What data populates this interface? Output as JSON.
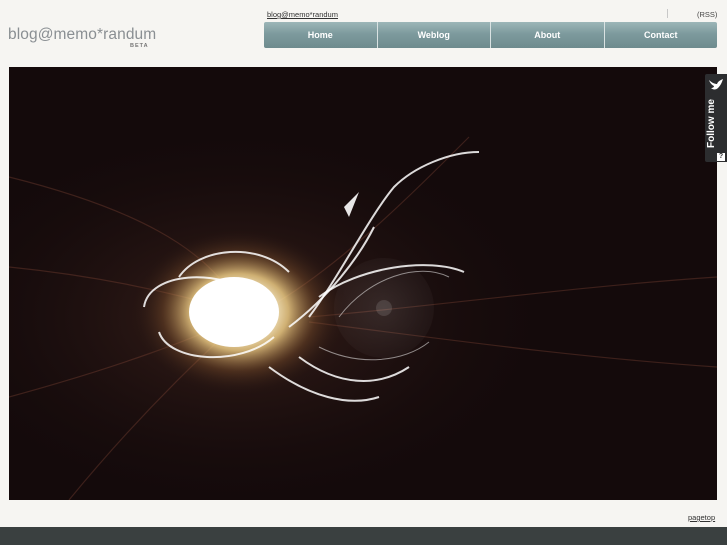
{
  "brand": {
    "logo_text": "blog@memo*randum",
    "beta_label": "BETA"
  },
  "header": {
    "top_link": "blog@memo*randum",
    "rss_label": "(RSS)"
  },
  "nav": {
    "items": [
      {
        "label": "Home"
      },
      {
        "label": "Weblog"
      },
      {
        "label": "About"
      },
      {
        "label": "Contact"
      }
    ]
  },
  "follow_widget": {
    "label": "Follow me",
    "help": "?"
  },
  "footer": {
    "pagetop_label": "pagetop"
  },
  "colors": {
    "background": "#f6f5f2",
    "nav": "#7d9a9d",
    "hero": "#140a0b",
    "footer": "#3a4040"
  }
}
